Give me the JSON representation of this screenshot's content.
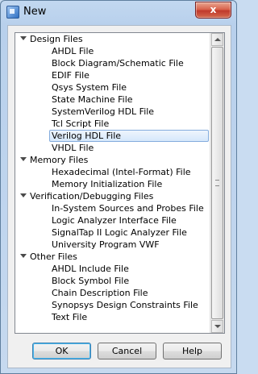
{
  "window": {
    "title": "New",
    "close_label": "x"
  },
  "tree": {
    "groups": [
      {
        "label": "Design Files",
        "items": [
          "AHDL File",
          "Block Diagram/Schematic File",
          "EDIF File",
          "Qsys System File",
          "State Machine File",
          "SystemVerilog HDL File",
          "Tcl Script File",
          "Verilog HDL File",
          "VHDL File"
        ]
      },
      {
        "label": "Memory Files",
        "items": [
          "Hexadecimal (Intel-Format) File",
          "Memory Initialization File"
        ]
      },
      {
        "label": "Verification/Debugging Files",
        "items": [
          "In-System Sources and Probes File",
          "Logic Analyzer Interface File",
          "SignalTap II Logic Analyzer File",
          "University Program VWF"
        ]
      },
      {
        "label": "Other Files",
        "items": [
          "AHDL Include File",
          "Block Symbol File",
          "Chain Description File",
          "Synopsys Design Constraints File",
          "Text File"
        ]
      }
    ],
    "selected_item": "Verilog HDL File"
  },
  "buttons": {
    "ok": "OK",
    "cancel": "Cancel",
    "help": "Help"
  }
}
